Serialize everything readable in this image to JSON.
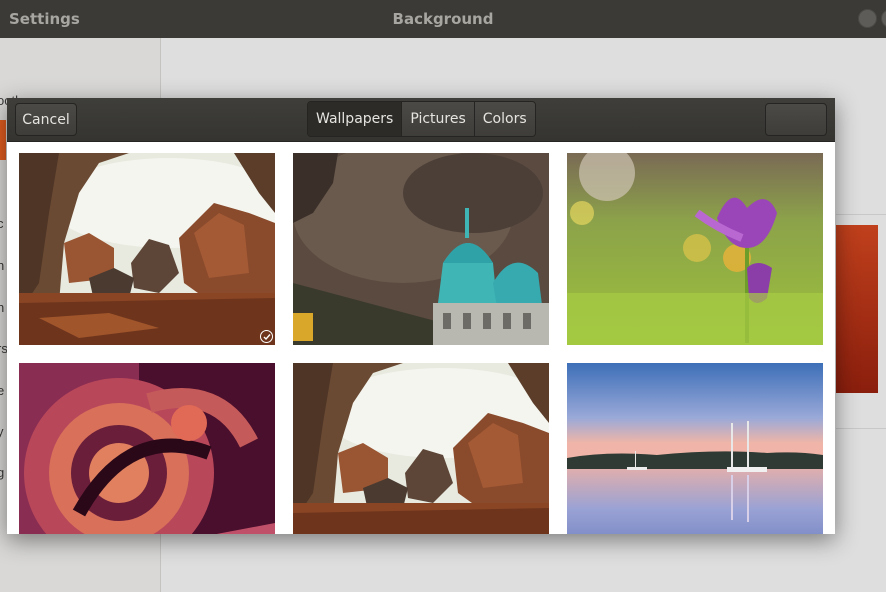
{
  "window": {
    "app_title": "Settings",
    "title": "Background"
  },
  "sidebar": {
    "fragments": [
      "ooth",
      "c",
      "n",
      "n",
      "rs",
      "e",
      "y",
      "g"
    ]
  },
  "dialog": {
    "cancel_label": "Cancel",
    "tabs": [
      {
        "label": "Wallpapers",
        "active": true
      },
      {
        "label": "Pictures",
        "active": false
      },
      {
        "label": "Colors",
        "active": false
      }
    ],
    "select_label": "",
    "selected_index": 0,
    "wallpapers": [
      {
        "name": "rocky-canyon-wallpaper",
        "selected": true
      },
      {
        "name": "cathedral-dome-wallpaper",
        "selected": false
      },
      {
        "name": "crocus-flower-wallpaper",
        "selected": false
      },
      {
        "name": "abstract-swirl-wallpaper",
        "selected": false
      },
      {
        "name": "rocky-canyon-wallpaper",
        "selected": false
      },
      {
        "name": "lake-harbor-wallpaper",
        "selected": false
      }
    ]
  },
  "colors": {
    "titlebar": "#3b3a36",
    "accent": "#e05c1f",
    "dialog_header": "#3a3935"
  }
}
